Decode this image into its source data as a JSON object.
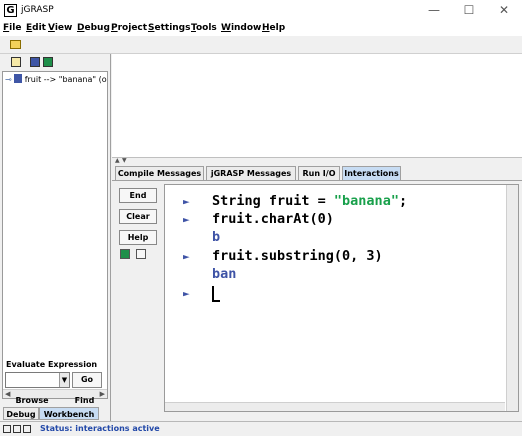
{
  "window": {
    "title": "jGRASP",
    "app_icon": "G",
    "minimize_glyph": "—",
    "maximize_glyph": "☐",
    "close_glyph": "✕"
  },
  "menubar": {
    "items": [
      {
        "first": "F",
        "rest": "ile"
      },
      {
        "first": "E",
        "rest": "dit"
      },
      {
        "first": "V",
        "rest": "iew"
      },
      {
        "first": "D",
        "rest": "ebug"
      },
      {
        "first": "P",
        "rest": "roject"
      },
      {
        "first": "S",
        "rest": "ettings"
      },
      {
        "first": "T",
        "rest": "ools"
      },
      {
        "first": "W",
        "rest": "indow"
      },
      {
        "first": "H",
        "rest": "elp"
      }
    ]
  },
  "workbench": {
    "tree_item": "fruit --> \"banana\" (ol",
    "toggle": "⊸"
  },
  "evaluate": {
    "label": "Evaluate Expression",
    "go": "Go",
    "browse": "Browse",
    "find": "Find"
  },
  "left_tabs": {
    "debug": "Debug",
    "workbench": "Workbench"
  },
  "message_tabs": [
    {
      "label": "Compile Messages"
    },
    {
      "label": "jGRASP Messages"
    },
    {
      "label": "Run I/O"
    },
    {
      "label": "Interactions"
    }
  ],
  "side_buttons": {
    "end": "End",
    "clear": "Clear",
    "help": "Help"
  },
  "interactions": {
    "prompt_glyph": "►",
    "stmt1_prefix": "String fruit = ",
    "stmt1_string": "\"banana\"",
    "stmt1_suffix": ";",
    "stmt2": "fruit.charAt(0)",
    "out2": "b",
    "stmt3": "fruit.substring(0, 3)",
    "out3": "ban"
  },
  "status": {
    "text": "Status: interactions active"
  },
  "colors": {
    "prompt": "#3e53a6",
    "string_literal": "#18a04b",
    "active_tab": "#c7dcf3",
    "status_text": "#2248a8"
  }
}
